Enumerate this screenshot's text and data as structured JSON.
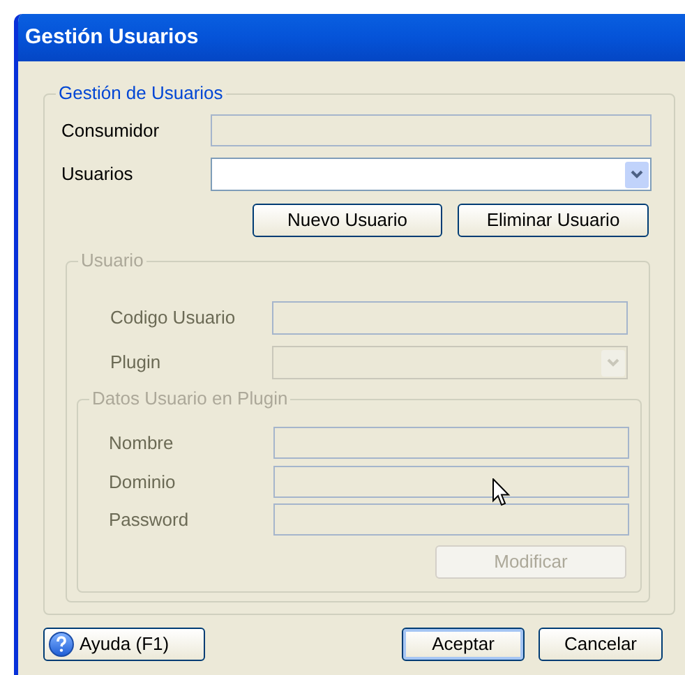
{
  "window": {
    "title": "Gestión Usuarios"
  },
  "main_group": {
    "legend": "Gestión de Usuarios",
    "fields": [
      {
        "label": "Consumidor",
        "kind": "text",
        "disabled": true
      },
      {
        "label": "Usuarios",
        "kind": "combo",
        "disabled": false
      }
    ],
    "buttons": [
      {
        "label": "Nuevo Usuario",
        "disabled": false
      },
      {
        "label": "Eliminar Usuario",
        "disabled": false
      }
    ]
  },
  "user_group": {
    "legend": "Usuario",
    "disabled": true,
    "fields": [
      {
        "label": "Codigo Usuario",
        "kind": "text"
      },
      {
        "label": "Plugin",
        "kind": "combo"
      }
    ],
    "plugin_group": {
      "legend": "Datos Usuario en Plugin",
      "fields": [
        {
          "label": "Nombre",
          "kind": "text"
        },
        {
          "label": "Dominio",
          "kind": "text"
        },
        {
          "label": "Password",
          "kind": "text"
        }
      ],
      "button": {
        "label": "Modificar",
        "disabled": true
      }
    }
  },
  "footer_buttons": [
    {
      "label": "Ayuda (F1)",
      "kind": "help"
    },
    {
      "label": "Aceptar",
      "kind": "default"
    },
    {
      "label": "Cancelar",
      "kind": "plain"
    }
  ]
}
